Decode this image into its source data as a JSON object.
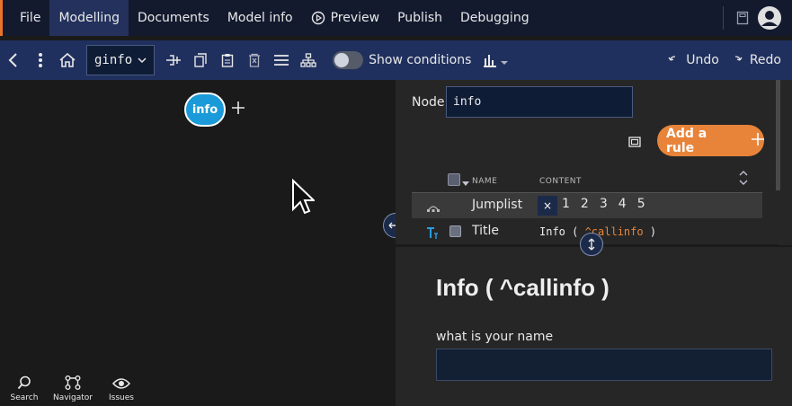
{
  "menu": {
    "items": [
      {
        "label": "File"
      },
      {
        "label": "Modelling",
        "active": true
      },
      {
        "label": "Documents"
      },
      {
        "label": "Model info"
      },
      {
        "label": "Preview",
        "icon": "play-circle-icon"
      },
      {
        "label": "Publish"
      },
      {
        "label": "Debugging"
      }
    ]
  },
  "toolbar": {
    "node_select": "ginfo",
    "show_conditions_label": "Show conditions",
    "show_conditions_on": false,
    "undo_label": "Undo",
    "redo_label": "Redo"
  },
  "canvas": {
    "node_label": "info"
  },
  "bottom_tools": [
    {
      "label": "Search",
      "icon": "search-icon"
    },
    {
      "label": "Navigator",
      "icon": "navigator-icon"
    },
    {
      "label": "Issues",
      "icon": "eye-icon"
    }
  ],
  "panel": {
    "node_label": "Node",
    "node_value": "info",
    "add_rule_label": "Add a rule",
    "columns": {
      "name": "NAME",
      "content": "CONTENT"
    },
    "rows": [
      {
        "name": "Jumplist",
        "icon": "jumplist-icon",
        "jump_x": "×",
        "numbers": [
          "1",
          "2",
          "3",
          "4",
          "5"
        ]
      },
      {
        "name": "Title",
        "icon": "title-icon",
        "content_prefix": "Info ( ",
        "content_highlight": "^callinfo",
        "content_suffix": " )"
      }
    ]
  },
  "preview": {
    "title": "Info ( ^callinfo )",
    "question_label": "what is your name",
    "answer_value": ""
  },
  "colors": {
    "menubar_bg": "#131a2e",
    "toolbar_bg": "#20305e",
    "accent_orange": "#e8843a",
    "node_blue": "#1a9ad8"
  }
}
